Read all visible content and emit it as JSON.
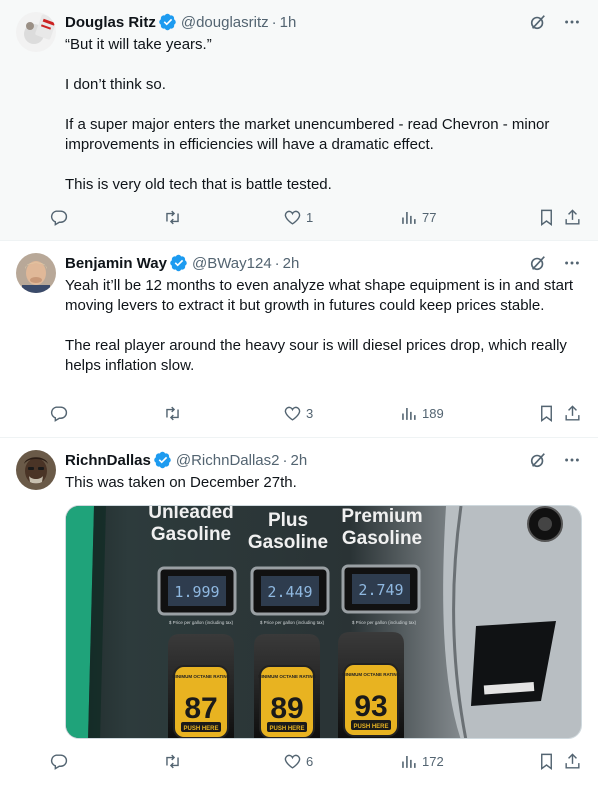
{
  "tweets": [
    {
      "name": "Douglas Ritz",
      "handle": "@douglasritz",
      "time": "1h",
      "paragraphs": [
        "“But it will take years.”",
        "I don’t think so.",
        "If a super major enters the market unencumbered - read Chevron - minor improvements in efficiencies will have a dramatic effect.",
        "This is very old tech that is battle tested."
      ],
      "replies": "",
      "retweets": "",
      "likes": "1",
      "views": "77"
    },
    {
      "name": "Benjamin Way",
      "handle": "@BWay124",
      "time": "2h",
      "paragraphs": [
        "Yeah it’ll be 12 months to even analyze what shape equipment is in and start moving levers to extract it but growth in futures could keep prices stable.",
        "The real player around the heavy sour is will diesel prices drop, which really helps inflation slow."
      ],
      "replies": "",
      "retweets": "",
      "likes": "3",
      "views": "189"
    },
    {
      "name": "RichnDallas",
      "handle": "@RichnDallas2",
      "time": "2h",
      "paragraphs": [
        "This was taken on December 27th."
      ],
      "replies": "",
      "retweets": "",
      "likes": "6",
      "views": "172"
    }
  ],
  "photo": {
    "grades": [
      {
        "label1": "Unleaded",
        "label2": "Gasoline",
        "price": "1.999",
        "octane": "87",
        "button": "PUSH HERE"
      },
      {
        "label1": "Plus",
        "label2": "Gasoline",
        "price": "2.449",
        "octane": "89",
        "button": "PUSH HERE"
      },
      {
        "label1": "Premium",
        "label2": "Gasoline",
        "price": "2.749",
        "octane": "93",
        "button": "PUSH HERE"
      }
    ],
    "price_caption": "$ Price per gallon (including tax)",
    "octane_caption": "MINIMUM OCTANE RATING"
  },
  "icons": {
    "verified": "verified-badge-icon",
    "grok": "grok-icon",
    "more": "more-icon",
    "reply": "reply-icon",
    "retweet": "retweet-icon",
    "like": "like-icon",
    "views": "views-icon",
    "bookmark": "bookmark-icon",
    "share": "share-icon"
  },
  "colors": {
    "verified": "#1d9bf0",
    "text": "#0f1419",
    "muted": "#536471"
  }
}
